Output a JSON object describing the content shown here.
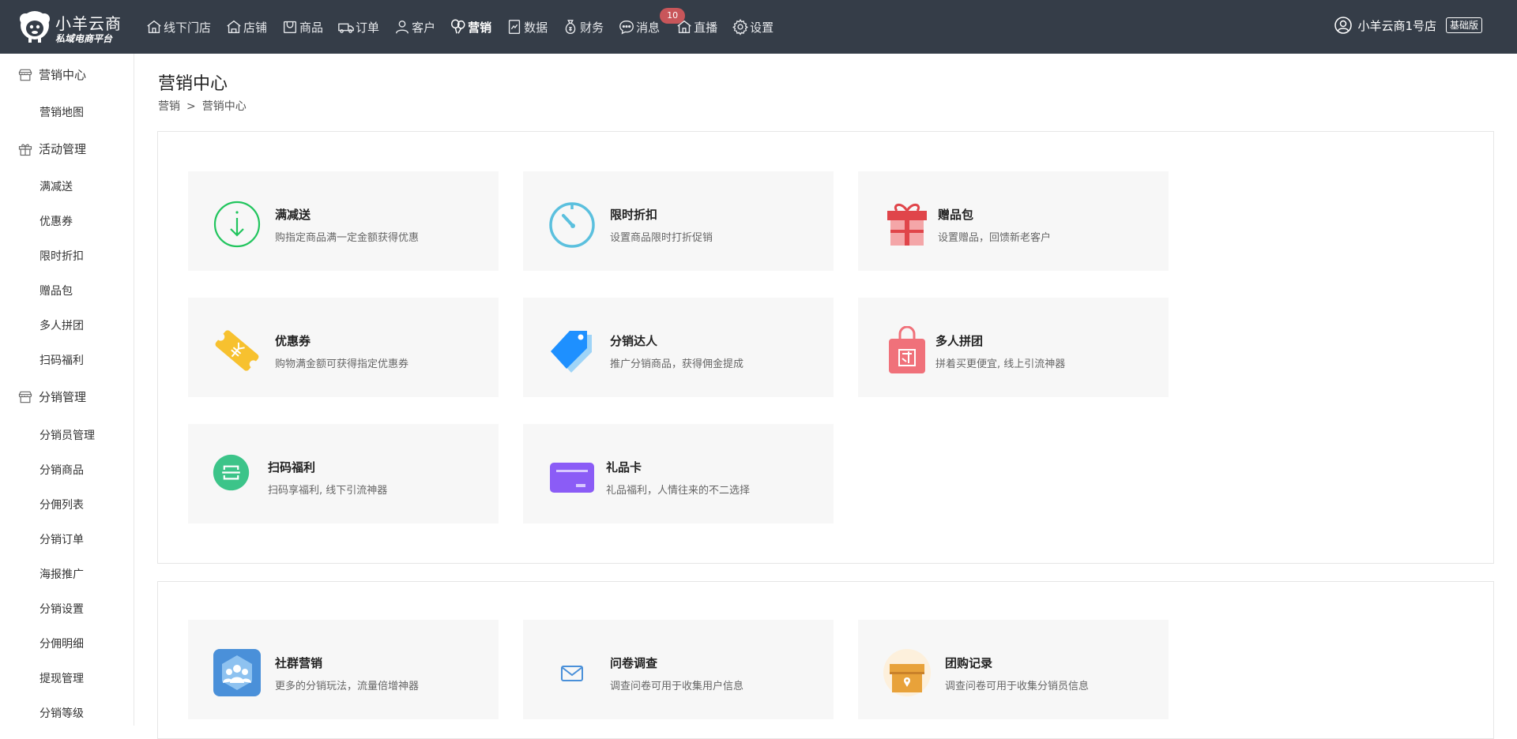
{
  "brand": {
    "name": "小羊云商",
    "tagline": "私域电商平台"
  },
  "nav": [
    {
      "label": "线下门店",
      "icon": "home-icon"
    },
    {
      "label": "店铺",
      "icon": "store-icon"
    },
    {
      "label": "商品",
      "icon": "shopping-bag-icon"
    },
    {
      "label": "订单",
      "icon": "truck-icon"
    },
    {
      "label": "客户",
      "icon": "user-icon"
    },
    {
      "label": "营销",
      "icon": "balloon-icon",
      "active": true
    },
    {
      "label": "数据",
      "icon": "report-icon"
    },
    {
      "label": "财务",
      "icon": "money-bag-icon"
    },
    {
      "label": "消息",
      "icon": "chat-icon",
      "badge": "10"
    },
    {
      "label": "直播",
      "icon": "home-icon"
    },
    {
      "label": "设置",
      "icon": "gear-icon"
    }
  ],
  "account": {
    "store": "小羊云商1号店",
    "edition": "基础版"
  },
  "sidebar": {
    "groups": [
      {
        "label": "营销中心",
        "icon": "store-icon",
        "items": [
          "营销地图"
        ]
      },
      {
        "label": "活动管理",
        "icon": "gift-icon",
        "items": [
          "满减送",
          "优惠券",
          "限时折扣",
          "赠品包",
          "多人拼团",
          "扫码福利"
        ]
      },
      {
        "label": "分销管理",
        "icon": "store-icon",
        "items": [
          "分销员管理",
          "分销商品",
          "分佣列表",
          "分销订单",
          "海报推广",
          "分销设置",
          "分佣明细",
          "提现管理",
          "分销等级"
        ]
      }
    ]
  },
  "page": {
    "title": "营销中心",
    "breadcrumb": [
      "营销",
      "营销中心"
    ],
    "breadcrumb_separator": ">"
  },
  "panel1": [
    {
      "title": "满减送",
      "desc": "购指定商品满一定金额获得优惠",
      "icon": "arrow-down-circle-icon",
      "color": "#22c55e"
    },
    {
      "title": "限时折扣",
      "desc": "设置商品限时打折促销",
      "icon": "timer-icon",
      "color": "#5bc0de"
    },
    {
      "title": "赠品包",
      "desc": "设置赠品，回馈新老客户",
      "icon": "gift-box-icon",
      "color": "#e0454a"
    },
    {
      "title": "优惠券",
      "desc": "购物满金额可获得指定优惠券",
      "icon": "coupon-icon",
      "color": "#f7c12f"
    },
    {
      "title": "分销达人",
      "desc": "推广分销商品，获得佣金提成",
      "icon": "price-tag-icon",
      "color": "#1e90ff"
    },
    {
      "title": "多人拼团",
      "desc": "拼着买更便宜, 线上引流神器",
      "icon": "group-bag-icon",
      "color": "#f0717a"
    },
    {
      "title": "扫码福利",
      "desc": "扫码享福利, 线下引流神器",
      "icon": "scan-icon",
      "color": "#3cc489"
    },
    {
      "title": "礼品卡",
      "desc": "礼品福利，人情往来的不二选择",
      "icon": "gift-card-icon",
      "color": "#8b5cf6"
    }
  ],
  "panel2": [
    {
      "title": "社群营销",
      "desc": "更多的分销玩法，流量倍增神器",
      "icon": "community-icon",
      "color": "#4a90d9"
    },
    {
      "title": "问卷调查",
      "desc": "调查问卷可用于收集用户信息",
      "icon": "mail-icon",
      "color": "#4a90d9"
    },
    {
      "title": "团购记录",
      "desc": "调查问卷可用于收集分销员信息",
      "icon": "shop-box-icon",
      "color": "#e8a23a"
    }
  ]
}
